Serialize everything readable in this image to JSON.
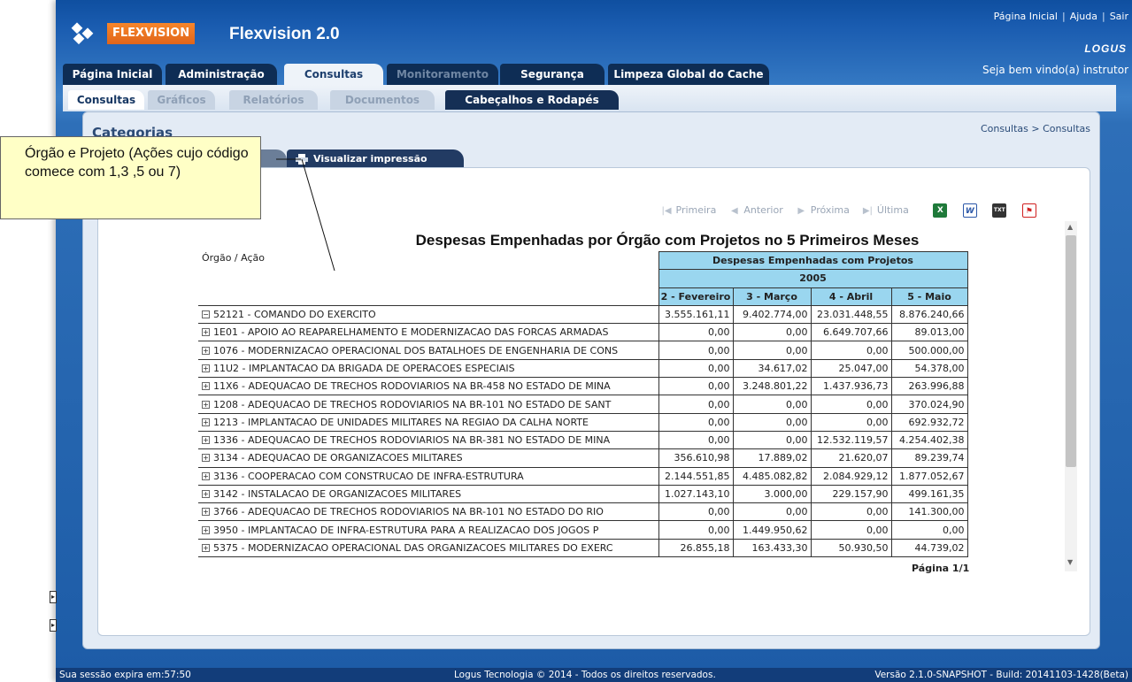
{
  "header": {
    "logo_text": "FLEXVISION",
    "app_title": "Flexvision 2.0",
    "links": [
      "Página Inicial",
      "Ajuda",
      "Sair"
    ],
    "brand": "LOGUS",
    "welcome": "Seja bem vindo(a) instrutor"
  },
  "main_tabs": [
    "Página Inicial",
    "Administração",
    "Consultas",
    "Monitoramento",
    "Segurança",
    "Limpeza Global do Cache"
  ],
  "sub_tabs": [
    "Consultas",
    "Gráficos",
    "Relatórios",
    "Documentos",
    "Cabeçalhos e Rodapés"
  ],
  "panel": {
    "title": "Categorias",
    "breadcrumb": "Consultas > Consultas",
    "print_tab": "Visualizar impressão"
  },
  "toolbar": {
    "first": "Primeira",
    "prev": "Anterior",
    "next": "Próxima",
    "last": "Última",
    "exports": [
      "excel-icon",
      "word-icon",
      "txt-icon",
      "pdf-icon"
    ]
  },
  "report": {
    "title": "Despesas Empenhadas por Órgão com Projetos no 5 Primeiros Meses",
    "row_header": "Órgão / Ação",
    "group_header": "Despesas Empenhadas com Projetos",
    "year": "2005",
    "months": [
      "2 - Fevereiro",
      "3 - Março",
      "4 - Abril",
      "5 - Maio"
    ],
    "rows": [
      {
        "label": "52121 - COMANDO DO EXERCITO",
        "expanded": true,
        "values": [
          "3.555.161,11",
          "9.402.774,00",
          "23.031.448,55",
          "8.876.240,66"
        ]
      },
      {
        "label": "1E01 - APOIO AO REAPARELHAMENTO E MODERNIZACAO DAS FORCAS ARMADAS",
        "values": [
          "0,00",
          "0,00",
          "6.649.707,66",
          "89.013,00"
        ]
      },
      {
        "label": "1076 - MODERNIZACAO OPERACIONAL DOS BATALHOES DE ENGENHARIA DE CONS",
        "values": [
          "0,00",
          "0,00",
          "0,00",
          "500.000,00"
        ]
      },
      {
        "label": "11U2 - IMPLANTACAO DA BRIGADA DE OPERACOES ESPECIAIS",
        "values": [
          "0,00",
          "34.617,02",
          "25.047,00",
          "54.378,00"
        ]
      },
      {
        "label": "11X6 - ADEQUACAO DE TRECHOS RODOVIARIOS NA BR-458 NO ESTADO DE MINA",
        "values": [
          "0,00",
          "3.248.801,22",
          "1.437.936,73",
          "263.996,88"
        ]
      },
      {
        "label": "1208 - ADEQUACAO DE TRECHOS RODOVIARIOS NA BR-101 NO ESTADO DE SANT",
        "values": [
          "0,00",
          "0,00",
          "0,00",
          "370.024,90"
        ]
      },
      {
        "label": "1213 - IMPLANTACAO DE UNIDADES MILITARES NA REGIAO DA CALHA NORTE",
        "values": [
          "0,00",
          "0,00",
          "0,00",
          "692.932,72"
        ]
      },
      {
        "label": "1336 - ADEQUACAO DE TRECHOS RODOVIARIOS NA BR-381 NO ESTADO DE MINA",
        "values": [
          "0,00",
          "0,00",
          "12.532.119,57",
          "4.254.402,38"
        ]
      },
      {
        "label": "3134 - ADEQUACAO DE ORGANIZACOES MILITARES",
        "values": [
          "356.610,98",
          "17.889,02",
          "21.620,07",
          "89.239,74"
        ]
      },
      {
        "label": "3136 - COOPERACAO COM CONSTRUCAO DE INFRA-ESTRUTURA",
        "values": [
          "2.144.551,85",
          "4.485.082,82",
          "2.084.929,12",
          "1.877.052,67"
        ]
      },
      {
        "label": "3142 - INSTALACAO DE ORGANIZACOES MILITARES",
        "values": [
          "1.027.143,10",
          "3.000,00",
          "229.157,90",
          "499.161,35"
        ]
      },
      {
        "label": "3766 - ADEQUACAO DE TRECHOS RODOVIARIOS NA BR-101 NO ESTADO DO RIO",
        "values": [
          "0,00",
          "0,00",
          "0,00",
          "141.300,00"
        ]
      },
      {
        "label": "3950 - IMPLANTACAO DE INFRA-ESTRUTURA PARA A REALIZACAO DOS JOGOS P",
        "values": [
          "0,00",
          "1.449.950,62",
          "0,00",
          "0,00"
        ]
      },
      {
        "label": "5375 - MODERNIZACAO OPERACIONAL DAS ORGANIZACOES MILITARES DO EXERC",
        "values": [
          "26.855,18",
          "163.433,30",
          "50.930,50",
          "44.739,02"
        ]
      }
    ],
    "page_label": "Página 1/1"
  },
  "callout": {
    "text": "Órgão e Projeto (Ações cujo código comece com 1,3 ,5 ou 7)"
  },
  "footer": {
    "session": "Sua sessão expira em:57:50",
    "copyright": "Logus Tecnologia © 2014 - Todos os direitos reservados.",
    "version": "Versão 2.1.0-SNAPSHOT - Build: 20141103-1428(Beta)"
  },
  "colors": {
    "header_blue": "#1a5cb0",
    "logo_orange": "#e0651a",
    "table_header": "#9ad6ef",
    "callout_bg": "#ffffc6"
  }
}
